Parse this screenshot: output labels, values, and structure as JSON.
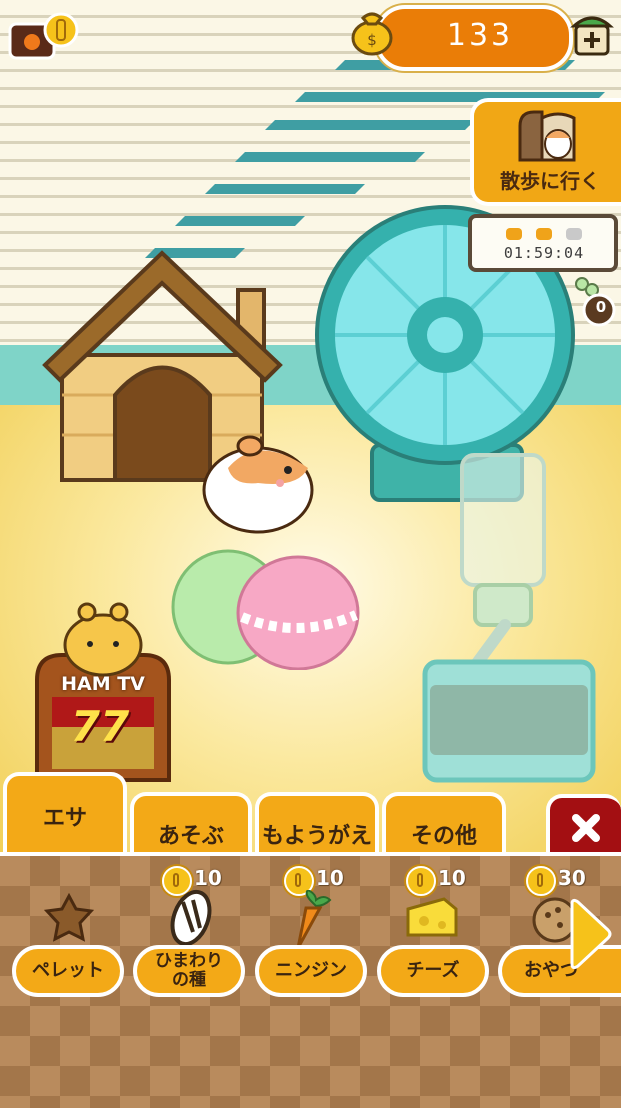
{
  "currency": {
    "amount": "133",
    "coin_color": "#f6c21a",
    "pill_color": "#ea7d07"
  },
  "header": {
    "camera_icon": "camera-icon",
    "shop_icon": "shop-icon"
  },
  "walk": {
    "label": "散歩に行く"
  },
  "timer": {
    "time": "01:59:04",
    "walk_counter": "0"
  },
  "hamtv": {
    "label": "HAM TV",
    "screen_text": "77"
  },
  "tabs": [
    {
      "label": "エサ",
      "active": true
    },
    {
      "label": "あそぶ"
    },
    {
      "label": "もようがえ"
    },
    {
      "label": "その他"
    }
  ],
  "items": [
    {
      "label": "ペレット",
      "price": "",
      "icon": "pellet-icon"
    },
    {
      "label": "ひまわり\nの種",
      "label_line1": "ひまわり",
      "label_line2": "の種",
      "price": "10",
      "icon": "sunflower-seed-icon"
    },
    {
      "label": "ニンジン",
      "price": "10",
      "icon": "carrot-icon"
    },
    {
      "label": "チーズ",
      "price": "10",
      "icon": "cheese-icon"
    },
    {
      "label": "おやつ",
      "price": "30",
      "icon": "cookie-icon"
    }
  ],
  "colors": {
    "accent": "#f3a917",
    "wall": "#7fd4c8",
    "close": "#a30f12"
  }
}
